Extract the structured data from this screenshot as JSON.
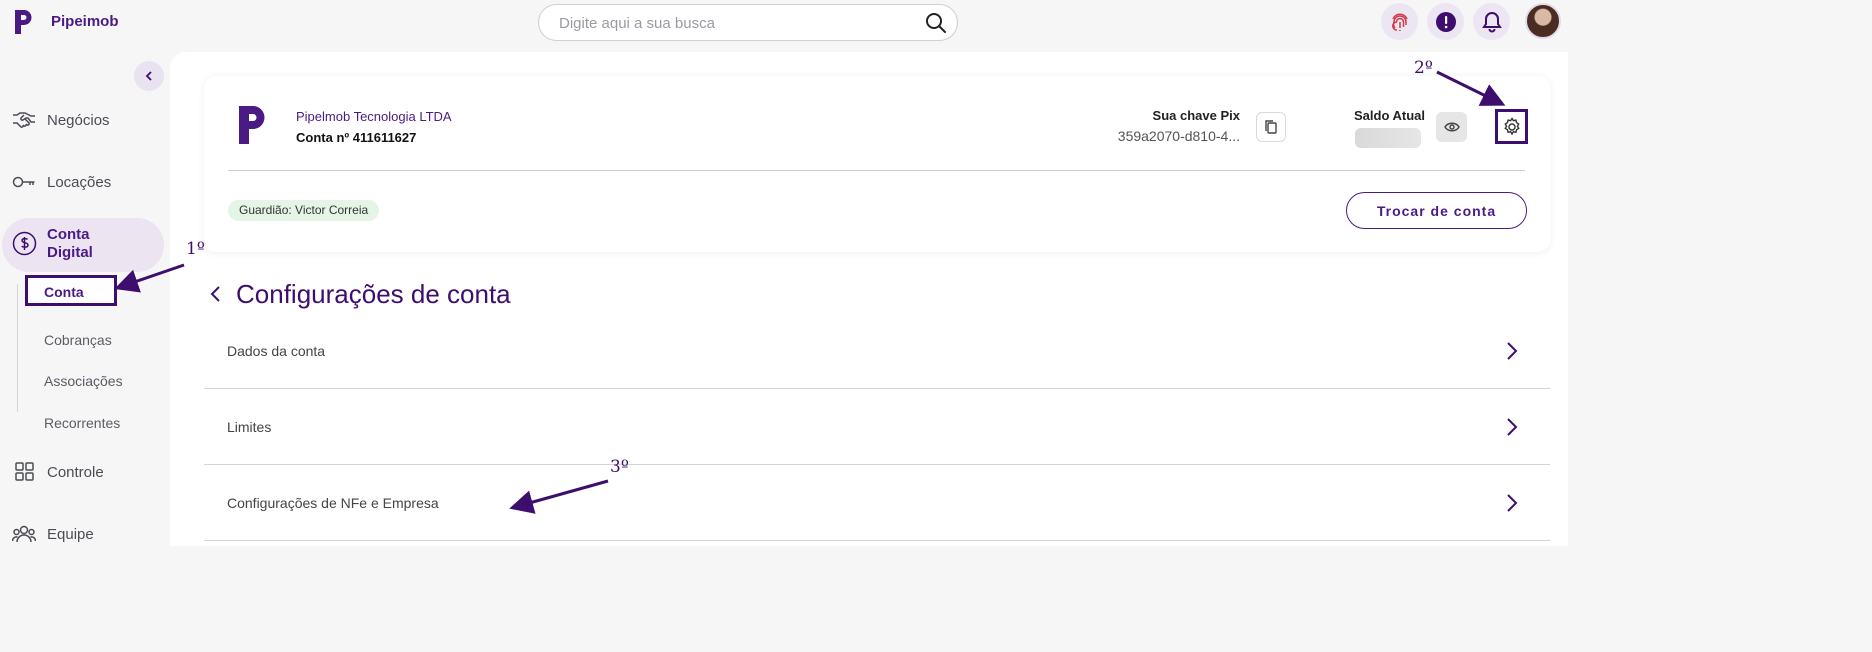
{
  "app": {
    "brand": "Pipeimob"
  },
  "search": {
    "placeholder": "Digite aqui a sua busca"
  },
  "sidebar": {
    "items": [
      {
        "label": "Negócios"
      },
      {
        "label": "Locações"
      },
      {
        "label": "Conta Digital"
      },
      {
        "label": "Controle"
      },
      {
        "label": "Equipe"
      }
    ],
    "subitems": [
      {
        "label": "Conta"
      },
      {
        "label": "Cobranças"
      },
      {
        "label": "Associações"
      },
      {
        "label": "Recorrentes"
      }
    ]
  },
  "account_card": {
    "company_name": "Pipelmob Tecnologia LTDA",
    "account_number": "Conta nº 411611627",
    "pix_title": "Sua chave Pix",
    "pix_key": "359a2070-d810-4...",
    "balance_title": "Saldo Atual",
    "guardian_badge": "Guardião: Victor Correia",
    "switch_button": "Trocar de conta"
  },
  "page": {
    "title": "Configurações de conta",
    "rows": [
      {
        "label": "Dados da conta"
      },
      {
        "label": "Limites"
      },
      {
        "label": "Configurações de NFe e Empresa"
      }
    ]
  },
  "annotations": {
    "step1": "1º",
    "step2": "2º",
    "step3": "3º"
  },
  "colors": {
    "brand_purple": "#4a1b85",
    "annotation_purple": "#3d0e6e",
    "badge_green": "#e4f4e6"
  }
}
